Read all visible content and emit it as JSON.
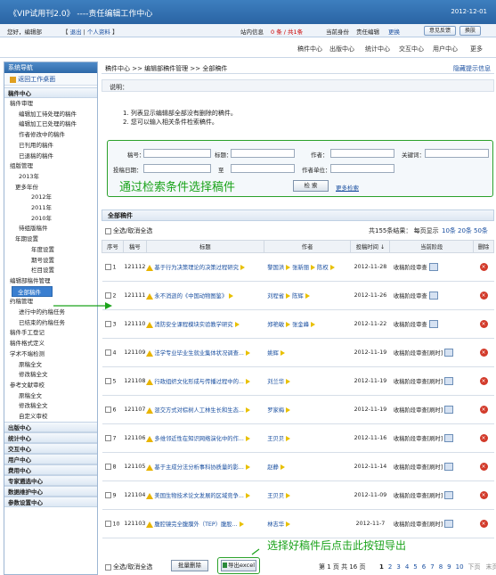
{
  "app_title": "《VIP试用刊2.0》 ----责任编辑工作中心",
  "date": "2012-12-01",
  "userbar": {
    "greeting": "您好，编辑部",
    "logout": "退出",
    "profile": "个人资料",
    "inbox_label": "站内信息",
    "inbox_count": "0 条 / 共1条",
    "current_role_label": "当前身份",
    "current_role": "责任编辑",
    "change_role": "更换",
    "feedback": "意见反馈",
    "switch": "换肤"
  },
  "topnav": [
    "稿件中心",
    "出版中心",
    "统计中心",
    "交互中心",
    "用户中心",
    "更多"
  ],
  "sidebar": {
    "title": "系统导航",
    "home": "返回工作桌面",
    "items": [
      {
        "label": "稿件中心",
        "type": "sec"
      },
      {
        "label": "稿件审理",
        "type": "group"
      },
      {
        "label": "编辑加工待处理的稿件",
        "type": "item"
      },
      {
        "label": "编辑加工已处理的稿件",
        "type": "item"
      },
      {
        "label": "作者修改中的稿件",
        "type": "item"
      },
      {
        "label": "已刊用的稿件",
        "type": "item"
      },
      {
        "label": "已退稿的稿件",
        "type": "item"
      },
      {
        "label": "组版管理",
        "type": "group"
      },
      {
        "label": "2013年",
        "type": "item"
      },
      {
        "label": "更多年份",
        "type": "group2"
      },
      {
        "label": "2012年",
        "type": "item2"
      },
      {
        "label": "2011年",
        "type": "item2"
      },
      {
        "label": "2010年",
        "type": "item2"
      },
      {
        "label": "待组版稿件",
        "type": "item"
      },
      {
        "label": "年期设置",
        "type": "group2"
      },
      {
        "label": "年度设置",
        "type": "item2"
      },
      {
        "label": "期号设置",
        "type": "item2"
      },
      {
        "label": "栏目设置",
        "type": "item2"
      },
      {
        "label": "编辑部稿件管理",
        "type": "group"
      },
      {
        "label": "全部稿件",
        "type": "active"
      },
      {
        "label": "约稿管理",
        "type": "group"
      },
      {
        "label": "进行中的约稿任务",
        "type": "item"
      },
      {
        "label": "已结束的约稿任务",
        "type": "item"
      },
      {
        "label": "稿件手工登记",
        "type": "plain"
      },
      {
        "label": "稿件格式定义",
        "type": "plain"
      },
      {
        "label": "学术不端检测",
        "type": "plain"
      },
      {
        "label": "原稿全文",
        "type": "item"
      },
      {
        "label": "修改稿全文",
        "type": "item"
      },
      {
        "label": "参考文献审校",
        "type": "plain"
      },
      {
        "label": "原稿全文",
        "type": "item"
      },
      {
        "label": "修改稿全文",
        "type": "item"
      },
      {
        "label": "自定义审校",
        "type": "item"
      },
      {
        "label": "出版中心",
        "type": "sec"
      },
      {
        "label": "统计中心",
        "type": "sec"
      },
      {
        "label": "交互中心",
        "type": "sec"
      },
      {
        "label": "用户中心",
        "type": "sec"
      },
      {
        "label": "费用中心",
        "type": "sec"
      },
      {
        "label": "专家遴选中心",
        "type": "sec"
      },
      {
        "label": "数据维护中心",
        "type": "sec"
      },
      {
        "label": "参数设置中心",
        "type": "sec"
      }
    ]
  },
  "breadcrumb": "稿件中心 >> 编辑部稿件管理 >> 全部稿件",
  "hide_tips": "隐藏提示信息",
  "explain_title": "说明：",
  "tips": [
    "1. 列表显示编辑部全部没有删除的稿件。",
    "2. 您可以输入相关条件检索稿件。"
  ],
  "search": {
    "manuscript_no": "稿号：",
    "title": "标题：",
    "author": "作者：",
    "keyword": "关键词：",
    "submit_date": "投稿日期：",
    "to": "至",
    "author_unit": "作者单位：",
    "search_btn": "检 索",
    "advanced": "更多检索"
  },
  "annot_search": "通过检索条件选择稿件",
  "list": {
    "title": "全部稿件",
    "select_all": "全选/取消全选",
    "summary": "共155条结果：  每页显示",
    "page_sizes": [
      "10条",
      "20条",
      "50条"
    ],
    "columns": [
      "序号",
      "稿号",
      "标题",
      "作者",
      "投稿时间 ↓",
      "当前阶段",
      "删除"
    ],
    "rows": [
      {
        "idx": "1",
        "no": "121112",
        "title": "基于行为决策理论的决策过程研究",
        "authors": [
          "黎国洪",
          "张新丽",
          "陈权"
        ],
        "date": "2012-11-28",
        "stage": "收稿阶段审查"
      },
      {
        "idx": "2",
        "no": "121111",
        "title": "永不消逝的《中国动物图鉴》",
        "authors": [
          "刘程省",
          "陈辉"
        ],
        "date": "2012-11-26",
        "stage": "收稿阶段审查"
      },
      {
        "idx": "3",
        "no": "121110",
        "title": "消防安全课程模块实验教学研究",
        "authors": [
          "郑艳敏",
          "张金峰"
        ],
        "date": "2012-11-22",
        "stage": "收稿阶段审查"
      },
      {
        "idx": "4",
        "no": "121109",
        "title": "法学专业毕业生就业集体状况调查...",
        "authors": [
          "姚辉"
        ],
        "date": "2012-11-19",
        "stage": "收稿阶段审查[刷时]"
      },
      {
        "idx": "5",
        "no": "121108",
        "title": "行政组织文化形成与传播过程中的...",
        "authors": [
          "刘兰华"
        ],
        "date": "2012-11-19",
        "stage": "收稿阶段审查[刷时]"
      },
      {
        "idx": "6",
        "no": "121107",
        "title": "混交方式对棕树人工林生长和生态...",
        "authors": [
          "罗家梅"
        ],
        "date": "2012-11-19",
        "stage": "收稿阶段审查[刷时]"
      },
      {
        "idx": "7",
        "no": "121106",
        "title": "多维邻近性在知识网络演化中的作...",
        "authors": [
          "王贝贝"
        ],
        "date": "2012-11-16",
        "stage": "收稿阶段审查[刷时]"
      },
      {
        "idx": "8",
        "no": "121105",
        "title": "基于主成分法分析事科协质量的影...",
        "authors": [
          "赵静"
        ],
        "date": "2012-11-14",
        "stage": "收稿阶段审查[刷时]"
      },
      {
        "idx": "9",
        "no": "121104",
        "title": "美国生物技术论文发展的区域竞争...",
        "authors": [
          "王贝贝"
        ],
        "date": "2012-11-09",
        "stage": "收稿阶段审查[刷时]"
      },
      {
        "idx": "10",
        "no": "121103",
        "title": "腹腔镜完全腹膜外（TEP）腹股...",
        "authors": [
          "林志华"
        ],
        "date": "2012-11-7",
        "stage": "收稿阶段审查[刷时]"
      }
    ]
  },
  "footer": {
    "select_all": "全选/取消全选",
    "batch_delete": "批量删除",
    "export": "导出excel",
    "page_info": "第 1 页 共 16 页",
    "pages": [
      "1",
      "2",
      "3",
      "4",
      "5",
      "6",
      "7",
      "8",
      "9",
      "10"
    ],
    "next": "下页",
    "last": "末页"
  },
  "annot_export": "选择好稿件后点击此按钮导出",
  "colors": {
    "accent": "#2a64a3",
    "annotation": "#1ba31b",
    "flag": "#e8c000",
    "delete": "#d23a2a"
  }
}
